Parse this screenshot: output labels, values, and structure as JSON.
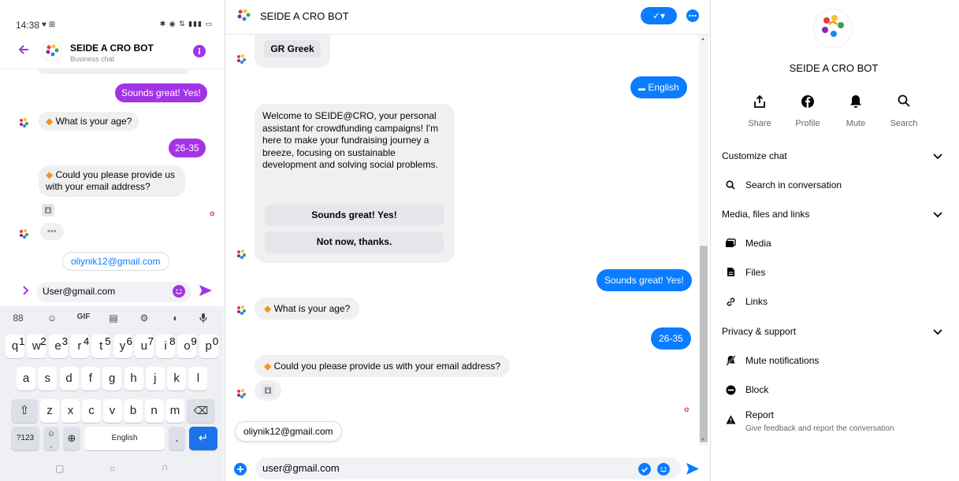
{
  "phone": {
    "status_time": "14:38",
    "status_right": "✱ ◉ ⇅ ▮▮▮ ▭",
    "header": {
      "title": "SEIDE A CRO BOT",
      "subtitle": "Business chat"
    },
    "messages": {
      "out1": "Sounds great! Yes!",
      "in_age": "What is your age?",
      "out_age": "26-35",
      "in_email_line1": "Could you please provide us",
      "in_email_line2": "with your email address?",
      "typing": "•••",
      "suggestion": "oliynik12@gmail.com"
    },
    "input_value": "User@gmail.com",
    "keyboard": {
      "tools": [
        "88",
        "☺",
        "GIF",
        "▤",
        "⚙",
        "◐",
        "🎤"
      ],
      "row1": [
        "q",
        "w",
        "e",
        "r",
        "t",
        "y",
        "u",
        "i",
        "o",
        "p"
      ],
      "row1_nums": [
        "1",
        "2",
        "3",
        "4",
        "5",
        "6",
        "7",
        "8",
        "9",
        "0"
      ],
      "row2": [
        "a",
        "s",
        "d",
        "f",
        "g",
        "h",
        "j",
        "k",
        "l"
      ],
      "row3": [
        "z",
        "x",
        "c",
        "v",
        "b",
        "n",
        "m"
      ],
      "num_key": "?123",
      "space_label": "English",
      "period_key": ".",
      "nav": [
        "▢",
        "○",
        "∩"
      ]
    }
  },
  "chat": {
    "title": "SEIDE A CRO BOT",
    "lang_greek": "GR Greek",
    "lang_english": "English",
    "welcome": "Welcome to SEIDE@CRO, your personal assistant for crowdfunding campaigns! I'm here to make your fundraising journey a breeze, focusing on sustainable development and solving social problems.",
    "btn_yes": "Sounds great! Yes!",
    "btn_no": "Not now, thanks.",
    "out_yes": "Sounds great! Yes!",
    "in_age": "What is your age?",
    "out_age": "26-35",
    "in_email": "Could you please provide us with your email address?",
    "suggestion": "oliynik12@gmail.com",
    "input_value": "user@gmail.com"
  },
  "info": {
    "name": "SEIDE A CRO BOT",
    "actions": [
      {
        "label": "Share"
      },
      {
        "label": "Profile"
      },
      {
        "label": "Mute"
      },
      {
        "label": "Search"
      }
    ],
    "sections": {
      "customize": "Customize chat",
      "search_conv": "Search in conversation",
      "media_files": "Media, files and links",
      "media": "Media",
      "files": "Files",
      "links": "Links",
      "privacy": "Privacy & support",
      "mute_notif": "Mute notifications",
      "block": "Block",
      "report": "Report",
      "report_sub": "Give feedback and report the conversation"
    }
  },
  "colors": {
    "messenger_blue": "#0a7cff",
    "phone_purple": "#a334e6",
    "bubble_gray": "#f0f0f0",
    "emoji_orange": "#f7931e"
  }
}
